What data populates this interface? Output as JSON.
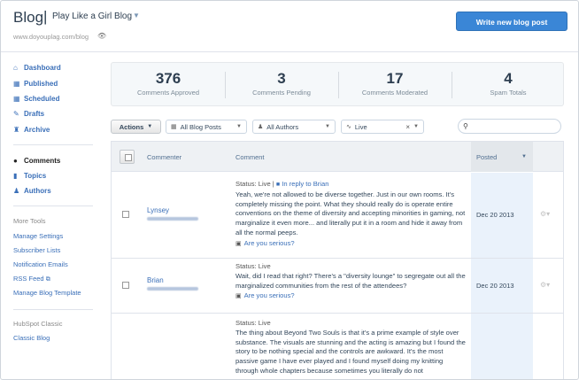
{
  "header": {
    "title": "Blog",
    "separator": "|",
    "blog_name": "Play Like a Girl Blog",
    "url": "www.doyouplag.com/blog",
    "write_button": "Write new blog post"
  },
  "sidebar": {
    "primary": [
      {
        "label": "Dashboard",
        "icon": "home-icon"
      },
      {
        "label": "Published",
        "icon": "calendar-icon"
      },
      {
        "label": "Scheduled",
        "icon": "calendar-icon"
      },
      {
        "label": "Drafts",
        "icon": "pencil-icon"
      },
      {
        "label": "Archive",
        "icon": "archive-icon"
      }
    ],
    "secondary": [
      {
        "label": "Comments",
        "icon": "comment-icon",
        "active": true
      },
      {
        "label": "Topics",
        "icon": "bookmark-icon"
      },
      {
        "label": "Authors",
        "icon": "person-icon"
      }
    ],
    "more_tools_heading": "More Tools",
    "more_tools": [
      "Manage Settings",
      "Subscriber Lists",
      "Notification Emails",
      "RSS Feed",
      "Manage Blog Template"
    ],
    "classic_heading": "HubSpot Classic",
    "classic_link": "Classic Blog"
  },
  "stats": [
    {
      "value": "376",
      "label": "Comments Approved"
    },
    {
      "value": "3",
      "label": "Comments Pending"
    },
    {
      "value": "17",
      "label": "Comments Moderated"
    },
    {
      "value": "4",
      "label": "Spam Totals"
    }
  ],
  "filters": {
    "actions_label": "Actions",
    "posts_label": "All Blog Posts",
    "authors_label": "All Authors",
    "status_label": "Live",
    "search_placeholder": ""
  },
  "table": {
    "col_commenter": "Commenter",
    "col_comment": "Comment",
    "col_posted": "Posted",
    "rows": [
      {
        "commenter": "Lynsey",
        "status": "Status: Live |",
        "reply": "In reply to Brian",
        "text": "Yeah, we're not allowed to be diverse together. Just in our own rooms. It's completely missing the point. What they should really do is operate entire conventions on the theme of diversity and accepting minorities in gaming, not marginalize it even more... and literally put it in a room and hide it away from all the normal peeps.",
        "post": "Are you serious?",
        "date": "Dec 20 2013"
      },
      {
        "commenter": "Brian",
        "status": "Status: Live",
        "reply": "",
        "text": "Wait, did I read that right? There's a \"diversity lounge\" to segregate out all the marginalized communities from the rest of the attendees?",
        "post": "Are you serious?",
        "date": "Dec 20 2013"
      },
      {
        "commenter": "",
        "status": "Status: Live",
        "reply": "",
        "text": "The thing about Beyond Two Souls is that it's a prime example of style over substance. The visuals are stunning and the acting is amazing but I found the story to be nothing special and the controls are awkward. It's the most passive game I have ever played and I found myself doing my knitting through whole chapters because sometimes you literally do not",
        "post": "",
        "date": ""
      }
    ]
  },
  "colors": {
    "accent": "#3a86d6",
    "link": "#3a6fb8",
    "posted_column": "#eaf2fb"
  }
}
